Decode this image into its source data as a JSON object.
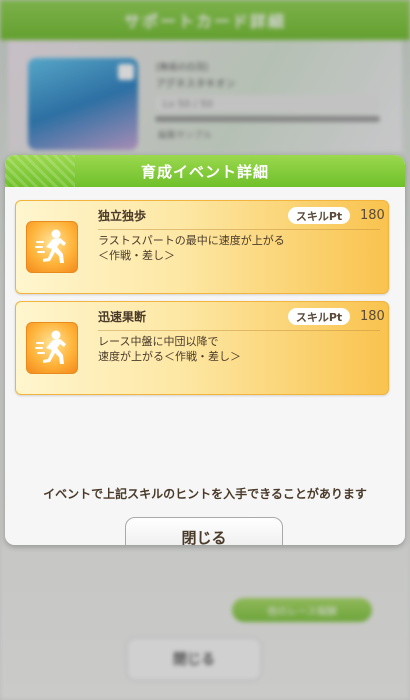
{
  "background": {
    "header_title": "サポートカード詳細",
    "card_title": "[無垢の白羽]",
    "card_name": "アグネスタキオン",
    "level_text": "Lv 50 / 50",
    "sub_text": "編集サンプル",
    "green_button_label": "他のレース報酬",
    "close_label": "閉じる"
  },
  "dialog": {
    "title": "育成イベント詳細",
    "hint": "イベントで上記スキルのヒントを入手できることがあります",
    "close_label": "閉じる",
    "skills": [
      {
        "name": "独立独歩",
        "pt_label": "スキルPt",
        "pt_value": "180",
        "desc_line1": "ラストスパートの最中に速度が上がる",
        "desc_line2": "＜作戦・差し＞",
        "icon": "running-speed-icon"
      },
      {
        "name": "迅速果断",
        "pt_label": "スキルPt",
        "pt_value": "180",
        "desc_line1": "レース中盤に中団以降で",
        "desc_line2": "速度が上がる＜作戦・差し＞",
        "icon": "running-speed-icon"
      }
    ]
  },
  "colors": {
    "header_green": "#7cc33b",
    "skill_card_gold": "#f9c34e",
    "text_brown": "#4a3a2a"
  }
}
